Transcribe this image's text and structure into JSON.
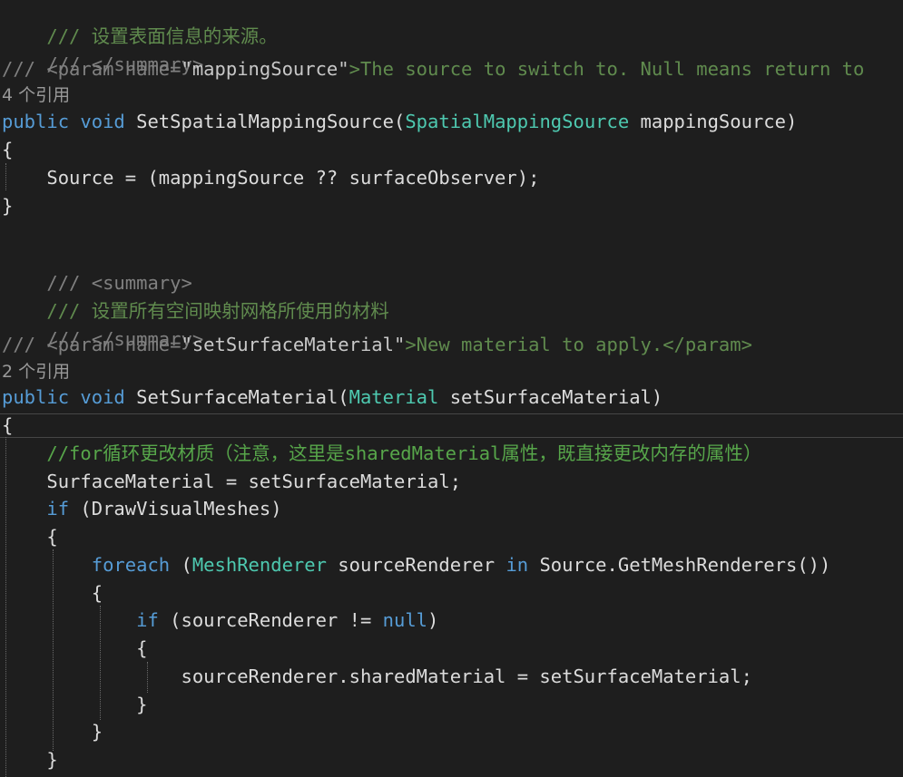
{
  "code": {
    "l1": "/// 设置表面信息的来源。",
    "l2": "/// </summary>",
    "l3_prefix": "/// <param name=",
    "l3_name": "\"mappingSource\"",
    "l3_rest": ">The source to switch to. Null means return to",
    "lens1": "4 个引用",
    "l4_kw1": "public",
    "l4_kw2": "void",
    "l4_method": "SetSpatialMappingSource(",
    "l4_type": "SpatialMappingSource",
    "l4_rest": " mappingSource)",
    "l5": "{",
    "l6": "Source = (mappingSource ?? surfaceObserver);",
    "l7": "}",
    "l8": "/// <summary>",
    "l9": "/// 设置所有空间映射网格所使用的材料",
    "l10": "/// </summary>",
    "l11_prefix": "/// <param name=",
    "l11_name": "\"setSurfaceMaterial\"",
    "l11_rest": ">New material to apply.</param>",
    "lens2": "2 个引用",
    "l12_kw1": "public",
    "l12_kw2": "void",
    "l12_method": "SetSurfaceMaterial(",
    "l12_type": "Material",
    "l12_rest": " setSurfaceMaterial)",
    "l13": "{",
    "l14": "//for循环更改材质（注意，这里是sharedMaterial属性，既直接更改内存的属性）",
    "l15": "SurfaceMaterial = setSurfaceMaterial;",
    "l16_kw": "if",
    "l16_rest": " (DrawVisualMeshes)",
    "l17": "{",
    "l18_kw": "foreach",
    "l18_sp": " (",
    "l18_type": "MeshRenderer",
    "l18_var": " sourceRenderer ",
    "l18_in": "in",
    "l18_rest": " Source.GetMeshRenderers())",
    "l19": "{",
    "l20_kw": "if",
    "l20_mid": " (sourceRenderer != ",
    "l20_null": "null",
    "l20_end": ")",
    "l21": "{",
    "l22": "sourceRenderer.sharedMaterial = setSurfaceMaterial;",
    "l23": "}",
    "l24": "}",
    "l25": "}"
  }
}
